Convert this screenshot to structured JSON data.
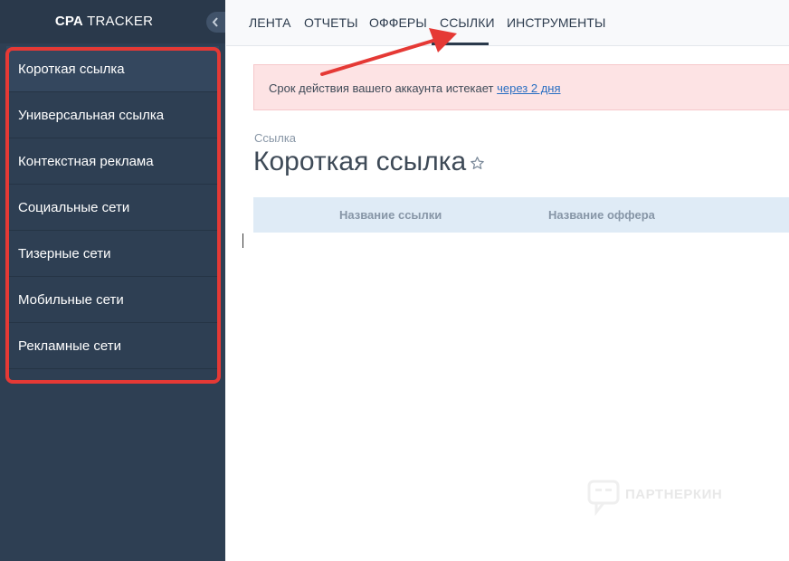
{
  "sidebar": {
    "brand_bold": "CPA",
    "brand_rest": "TRACKER",
    "items": [
      {
        "label": "Короткая ссылка"
      },
      {
        "label": "Универсальная ссылка"
      },
      {
        "label": "Контекстная реклама"
      },
      {
        "label": "Социальные сети"
      },
      {
        "label": "Тизерные сети"
      },
      {
        "label": "Мобильные сети"
      },
      {
        "label": "Рекламные сети"
      }
    ],
    "active_index": 0
  },
  "nav": {
    "tabs": [
      {
        "label": "ЛЕНТА"
      },
      {
        "label": "ОТЧЕТЫ"
      },
      {
        "label": "ОФФЕРЫ"
      },
      {
        "label": "ССЫЛКИ"
      },
      {
        "label": "ИНСТРУМЕНТЫ"
      }
    ],
    "active_tab": "ССЫЛКИ"
  },
  "alert": {
    "text": "Срок действия вашего аккаунта истекает ",
    "link": "через 2 дня"
  },
  "breadcrumb": "Ссылка",
  "page": {
    "title": "Короткая ссылка"
  },
  "table": {
    "columns": [
      "Название ссылки",
      "Название оффера"
    ]
  },
  "watermark": "ПАРТНЕРКИН",
  "colors": {
    "sidebar_bg": "#2e3f53",
    "alert_bg": "#fde3e4",
    "annotation": "#e53935",
    "link": "#2a6fc2"
  }
}
